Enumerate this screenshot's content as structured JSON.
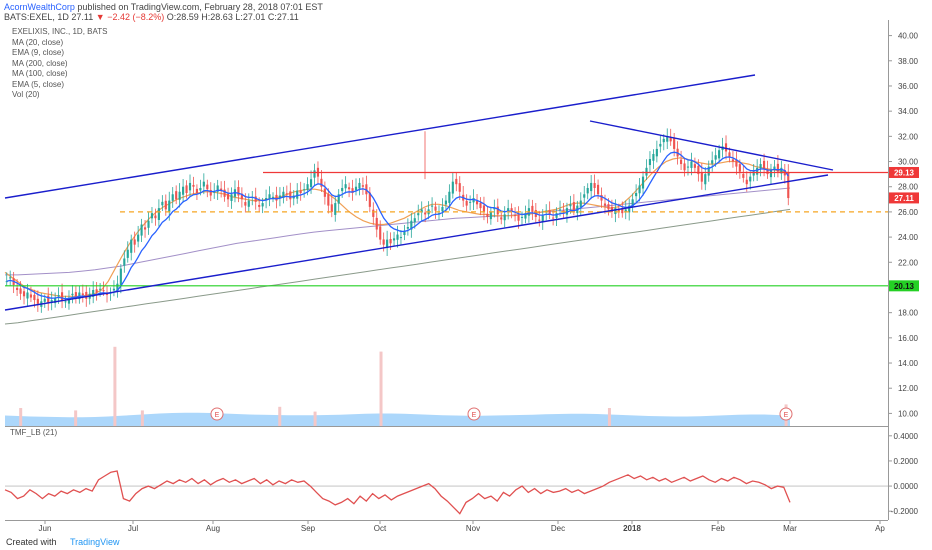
{
  "header": {
    "author": "AcornWealthCorp",
    "published_text": " published on TradingView.com, February 28, 2018 07:01 EST",
    "symbol_line": "BATS:EXEL, 1D",
    "last": "27.11",
    "change": "−2.42 (−8.2%)",
    "ohlc_o": "O:28.59",
    "ohlc_h": "H:28.63",
    "ohlc_l": "L:27.01",
    "ohlc_c": "C:27.11"
  },
  "legend": {
    "title": "EXELIXIS, INC., 1D, BATS",
    "studies": [
      "MA (20, close)",
      "EMA (9, close)",
      "MA (200, close)",
      "MA (100, close)",
      "EMA (5, close)",
      "Vol (20)"
    ]
  },
  "footer": {
    "created": "Created with",
    "brand": "TradingView"
  },
  "colors": {
    "up": "#26a69a",
    "down": "#ef5350",
    "trendline": "#1a1ecc",
    "resistance": "#ef3838",
    "support": "#24d024",
    "orange_dashed": "#f5a623",
    "ema9": "#2962ff",
    "ma20": "#f0a055",
    "ma100": "#a390c8",
    "ma200": "#8a9a8a",
    "volume": "#90caf9",
    "tmf": "#e05050"
  },
  "chart_data": {
    "type": "candlestick",
    "x_ticks": [
      "Jun",
      "Jul",
      "Aug",
      "Sep",
      "Oct",
      "Nov",
      "Dec",
      "2018",
      "Feb",
      "Mar",
      "Ap"
    ],
    "price_axis": {
      "ticks": [
        "40.00",
        "38.00",
        "36.00",
        "34.00",
        "32.00",
        "30.00",
        "28.00",
        "26.00",
        "24.00",
        "22.00",
        "20.00",
        "18.00",
        "16.00",
        "14.00",
        "12.00",
        "10.00"
      ],
      "range": [
        9.0,
        41.0
      ]
    },
    "price_labels": [
      {
        "value": 29.13,
        "text": "29.13",
        "color": "#ef3838"
      },
      {
        "value": 27.11,
        "text": "27.11",
        "color": "#ef3838"
      },
      {
        "value": 20.13,
        "text": "20.13",
        "color": "#24d024"
      }
    ],
    "horizontal_lines": [
      {
        "name": "resistance",
        "value": 29.13
      },
      {
        "name": "support",
        "value": 20.13
      },
      {
        "name": "dashed-level",
        "value": 26.0
      }
    ],
    "earnings_markers": [
      "E",
      "E",
      "E"
    ],
    "close_series": [
      20.5,
      20.8,
      20.2,
      19.8,
      19.5,
      19.3,
      19.6,
      19.2,
      19.0,
      18.7,
      18.9,
      19.1,
      18.8,
      19.0,
      19.2,
      19.4,
      19.0,
      18.9,
      19.2,
      19.5,
      19.3,
      19.6,
      19.4,
      19.1,
      19.5,
      19.8,
      19.6,
      19.9,
      19.7,
      19.4,
      19.6,
      19.9,
      20.3,
      21.5,
      22.3,
      23.0,
      23.8,
      23.4,
      24.2,
      25.0,
      24.6,
      25.3,
      25.9,
      25.5,
      26.3,
      26.8,
      26.2,
      26.9,
      27.4,
      27.0,
      27.6,
      28.0,
      27.5,
      28.3,
      28.0,
      27.5,
      27.9,
      28.4,
      27.8,
      27.3,
      27.6,
      28.1,
      27.7,
      27.2,
      27.0,
      27.4,
      27.8,
      27.3,
      27.0,
      26.5,
      26.9,
      27.2,
      26.8,
      26.4,
      26.7,
      27.1,
      27.4,
      27.2,
      26.9,
      27.3,
      27.6,
      27.4,
      27.0,
      27.3,
      27.7,
      27.5,
      27.8,
      28.2,
      28.6,
      29.3,
      28.8,
      28.0,
      27.2,
      26.5,
      26.0,
      26.7,
      27.4,
      27.9,
      28.2,
      27.8,
      27.5,
      28.0,
      28.3,
      28.0,
      27.4,
      26.4,
      25.6,
      24.6,
      23.8,
      23.4,
      23.8,
      23.5,
      23.9,
      24.2,
      24.0,
      24.5,
      24.8,
      25.3,
      25.5,
      25.9,
      26.2,
      25.8,
      26.2,
      26.5,
      26.1,
      25.9,
      26.4,
      26.9,
      27.6,
      28.4,
      28.2,
      27.6,
      26.9,
      26.5,
      26.8,
      27.1,
      26.6,
      26.3,
      26.0,
      25.6,
      26.0,
      26.3,
      25.8,
      25.4,
      25.8,
      26.3,
      26.0,
      25.7,
      25.3,
      25.6,
      25.9,
      26.3,
      26.0,
      25.6,
      25.3,
      25.7,
      26.1,
      25.8,
      25.5,
      25.9,
      26.2,
      26.0,
      26.3,
      26.6,
      26.1,
      26.5,
      26.9,
      27.4,
      27.9,
      28.3,
      27.9,
      27.4,
      26.9,
      26.5,
      26.2,
      26.0,
      26.3,
      26.1,
      25.9,
      26.2,
      26.5,
      27.0,
      27.5,
      28.1,
      28.8,
      29.5,
      30.2,
      30.6,
      31.0,
      31.4,
      31.8,
      32.0,
      31.6,
      31.0,
      30.4,
      29.8,
      29.3,
      29.6,
      30.0,
      29.5,
      29.0,
      28.4,
      29.0,
      29.6,
      30.1,
      30.5,
      30.9,
      31.2,
      30.8,
      30.4,
      30.0,
      29.6,
      29.2,
      28.7,
      28.2,
      28.8,
      29.2,
      29.5,
      29.8,
      29.4,
      29.0,
      29.3,
      29.6,
      29.2,
      29.5,
      28.9,
      27.1
    ],
    "ma20": [
      21.2,
      20.8,
      20.4,
      20.0,
      19.8,
      19.6,
      19.5,
      19.4,
      19.3,
      19.3,
      19.3,
      19.3,
      19.4,
      19.5,
      19.8,
      20.5,
      21.5,
      22.5,
      23.4,
      24.2,
      24.9,
      25.5,
      26.0,
      26.4,
      26.7,
      27.0,
      27.2,
      27.4,
      27.5,
      27.6,
      27.6,
      27.5,
      27.4,
      27.2,
      27.1,
      27.0,
      26.9,
      26.9,
      27.0,
      27.1,
      27.2,
      27.4,
      27.6,
      27.7,
      27.8,
      27.8,
      27.7,
      27.4,
      27.0,
      26.5,
      26.0,
      25.6,
      25.3,
      25.1,
      25.0,
      25.0,
      25.1,
      25.3,
      25.5,
      25.8,
      26.1,
      26.4,
      26.6,
      26.6,
      26.5,
      26.3,
      26.1,
      26.0,
      25.9,
      25.8,
      25.8,
      25.7,
      25.7,
      25.7,
      25.7,
      25.8,
      25.8,
      25.9,
      26.0,
      26.1,
      26.2,
      26.4,
      26.6,
      26.7,
      26.7,
      26.6,
      26.5,
      26.4,
      26.3,
      26.4,
      26.8,
      27.3,
      27.9,
      28.5,
      29.1,
      29.6,
      30.0,
      30.2,
      30.3,
      30.2,
      30.0,
      29.9,
      29.8,
      29.8,
      29.9,
      30.0,
      30.0,
      29.9,
      29.8,
      29.6,
      29.5,
      29.4,
      29.3,
      29.2,
      29.1
    ],
    "ma100": [
      21.0,
      21.0,
      21.05,
      21.1,
      21.15,
      21.2,
      21.3,
      21.4,
      21.55,
      21.7,
      21.9,
      22.1,
      22.3,
      22.5,
      22.7,
      22.9,
      23.1,
      23.3,
      23.5,
      23.65,
      23.8,
      23.95,
      24.1,
      24.25,
      24.4,
      24.5,
      24.6,
      24.7,
      24.8,
      24.9,
      25.0,
      25.1,
      25.2,
      25.3,
      25.4,
      25.5,
      25.55,
      25.6,
      25.65,
      25.7,
      25.8,
      25.9,
      26.0,
      26.1,
      26.2,
      26.3,
      26.4,
      26.5,
      26.6,
      26.7,
      26.8,
      26.9,
      27.0,
      27.1,
      27.2,
      27.3,
      27.4,
      27.5,
      27.6,
      27.7,
      27.8,
      27.9
    ],
    "ma200": [
      17.1,
      17.2,
      17.35,
      17.5,
      17.65,
      17.8,
      17.95,
      18.1,
      18.25,
      18.4,
      18.55,
      18.7,
      18.85,
      19.0,
      19.15,
      19.3,
      19.45,
      19.6,
      19.75,
      19.9,
      20.05,
      20.2,
      20.35,
      20.5,
      20.65,
      20.8,
      20.95,
      21.1,
      21.25,
      21.4,
      21.55,
      21.7,
      21.85,
      22.0,
      22.15,
      22.3,
      22.45,
      22.6,
      22.75,
      22.9,
      23.05,
      23.2,
      23.35,
      23.5,
      23.65,
      23.8,
      23.95,
      24.1,
      24.25,
      24.4,
      24.55,
      24.7,
      24.85,
      25.0,
      25.15,
      25.3,
      25.45,
      25.6,
      25.75,
      25.9,
      26.05,
      26.2
    ],
    "volume_avg": [
      0.42,
      0.4,
      0.38,
      0.37,
      0.36,
      0.35,
      0.35,
      0.36,
      0.38,
      0.41,
      0.44,
      0.47,
      0.5,
      0.52,
      0.53,
      0.53,
      0.52,
      0.5,
      0.48,
      0.46,
      0.45,
      0.44,
      0.43,
      0.43,
      0.43,
      0.44,
      0.45,
      0.47,
      0.49,
      0.5,
      0.5,
      0.49,
      0.47,
      0.45,
      0.43,
      0.42,
      0.41,
      0.41,
      0.42,
      0.43,
      0.44,
      0.45,
      0.47,
      0.48,
      0.49,
      0.49,
      0.48,
      0.46,
      0.44,
      0.42,
      0.4,
      0.39,
      0.38,
      0.38,
      0.39,
      0.41,
      0.43,
      0.45,
      0.46,
      0.46,
      0.44,
      0.41
    ],
    "volume_spikes": [
      {
        "t": 0.14,
        "v": 6.6
      },
      {
        "t": 0.479,
        "v": 6.2
      },
      {
        "t": 0.02,
        "v": 1.5
      },
      {
        "t": 0.09,
        "v": 1.3
      },
      {
        "t": 0.175,
        "v": 1.3
      },
      {
        "t": 0.35,
        "v": 1.6
      },
      {
        "t": 0.395,
        "v": 1.2
      },
      {
        "t": 0.77,
        "v": 1.5
      },
      {
        "t": 0.995,
        "v": 1.8
      }
    ],
    "tmf": {
      "label": "TMF_LB (21)",
      "ticks": [
        "0.4000",
        "0.2000",
        "0.0000",
        "-0.2000"
      ],
      "range": [
        -0.27,
        0.47
      ],
      "values": [
        -0.03,
        -0.05,
        -0.1,
        -0.08,
        -0.03,
        -0.06,
        -0.1,
        -0.06,
        -0.08,
        -0.04,
        -0.06,
        -0.03,
        -0.05,
        -0.02,
        -0.04,
        0.05,
        0.08,
        0.11,
        0.12,
        -0.1,
        -0.12,
        -0.06,
        -0.02,
        0.0,
        -0.02,
        0.01,
        0.04,
        0.02,
        0.05,
        0.03,
        0.06,
        0.02,
        0.05,
        0.01,
        0.04,
        0.06,
        0.03,
        0.05,
        0.02,
        0.04,
        0.06,
        0.02,
        0.05,
        0.01,
        0.04,
        0.02,
        0.05,
        0.03,
        0.04,
        0.0,
        -0.05,
        -0.1,
        -0.12,
        -0.15,
        -0.13,
        -0.1,
        -0.14,
        -0.08,
        -0.12,
        -0.06,
        -0.1,
        -0.07,
        -0.11,
        -0.08,
        -0.06,
        -0.04,
        -0.02,
        0.0,
        0.02,
        -0.02,
        -0.08,
        -0.12,
        -0.17,
        -0.22,
        -0.13,
        -0.1,
        -0.06,
        -0.1,
        -0.08,
        -0.12,
        -0.05,
        -0.08,
        -0.03,
        0.0,
        -0.05,
        -0.02,
        -0.06,
        -0.03,
        -0.05,
        -0.04,
        -0.02,
        -0.05,
        -0.03,
        -0.06,
        -0.04,
        -0.02,
        0.0,
        0.03,
        0.05,
        0.07,
        0.09,
        0.06,
        0.08,
        0.05,
        0.07,
        0.04,
        0.06,
        0.03,
        0.05,
        0.07,
        0.04,
        0.06,
        0.08,
        0.05,
        0.03,
        0.06,
        0.04,
        0.07,
        0.05,
        0.02,
        0.04,
        0.03,
        0.01,
        -0.02,
        0.0,
        -0.01,
        -0.13
      ]
    }
  }
}
